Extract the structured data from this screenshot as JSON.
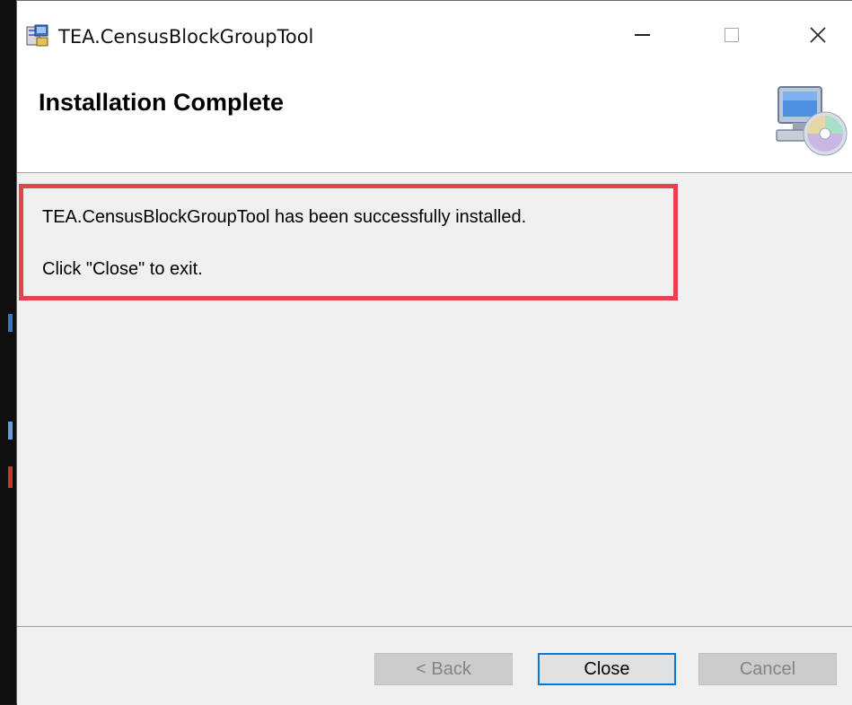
{
  "window": {
    "title": "TEA.CensusBlockGroupTool",
    "controls": {
      "minimize": "minimize",
      "maximize": "maximize",
      "close": "close"
    }
  },
  "banner": {
    "title": "Installation Complete",
    "icon": "computer-with-cd-icon"
  },
  "content": {
    "line1": "TEA.CensusBlockGroupTool has been successfully installed.",
    "line2": "Click \"Close\" to exit.",
    "highlight_color": "#e8424f"
  },
  "footer": {
    "back_label": "< Back",
    "close_label": "Close",
    "cancel_label": "Cancel",
    "back_enabled": false,
    "cancel_enabled": false,
    "accent_color": "#0078d7"
  }
}
